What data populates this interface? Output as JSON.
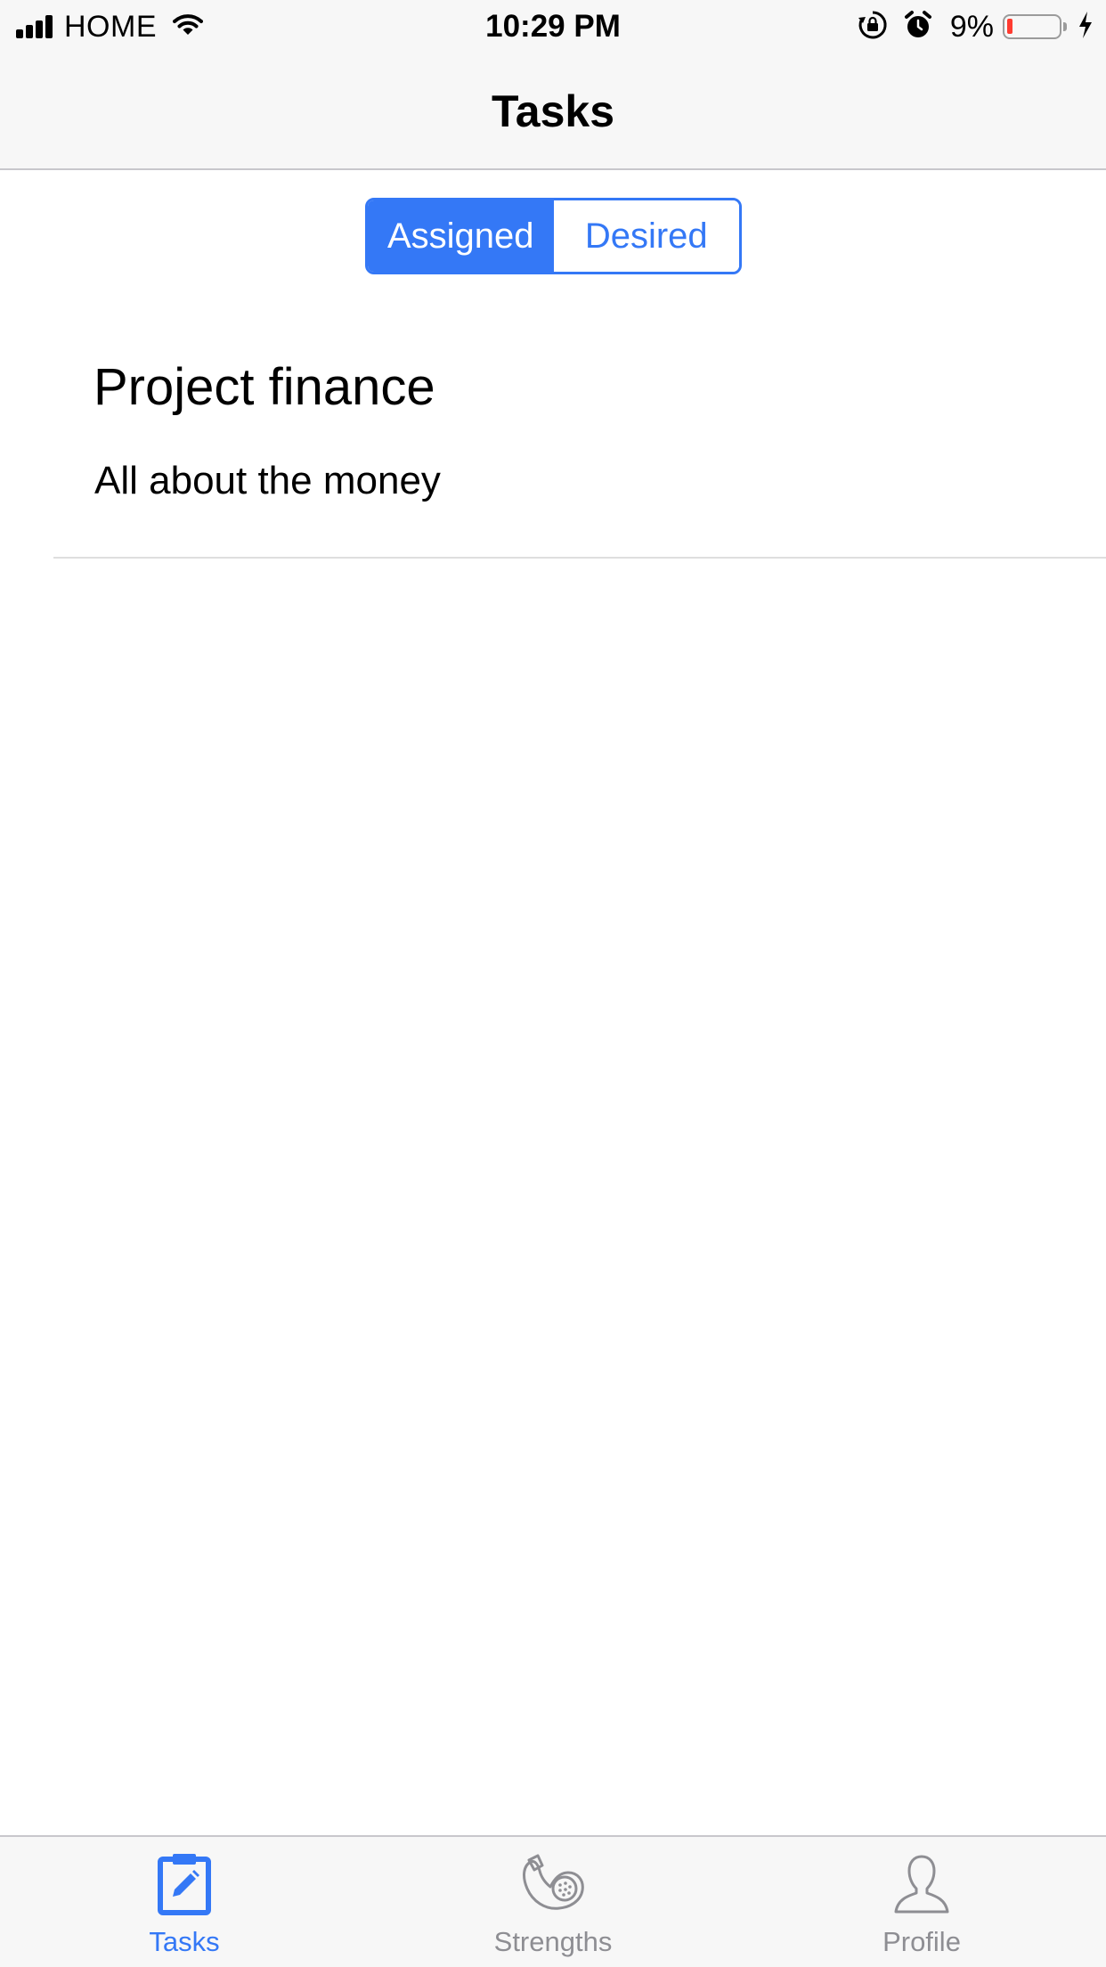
{
  "status_bar": {
    "carrier": "HOME",
    "time": "10:29 PM",
    "battery_percent": "9%",
    "battery_level": 0.09,
    "icons": [
      "signal-icon",
      "wifi-icon",
      "orientation-lock-icon",
      "alarm-icon",
      "battery-icon",
      "charging-bolt-icon"
    ]
  },
  "nav": {
    "title": "Tasks"
  },
  "segmented_control": {
    "segments": [
      {
        "label": "Assigned",
        "selected": true
      },
      {
        "label": "Desired",
        "selected": false
      }
    ]
  },
  "tasks": [
    {
      "title": "Project finance",
      "subtitle": "All about the money"
    }
  ],
  "tab_bar": {
    "tabs": [
      {
        "label": "Tasks",
        "icon": "clipboard-edit-icon",
        "active": true
      },
      {
        "label": "Strengths",
        "icon": "strengths-icon",
        "active": false
      },
      {
        "label": "Profile",
        "icon": "person-icon",
        "active": false
      }
    ]
  },
  "colors": {
    "accent": "#3478f6",
    "inactive": "#8e8e93",
    "bar_background": "#f7f7f7",
    "battery_low": "#ff3b30"
  }
}
